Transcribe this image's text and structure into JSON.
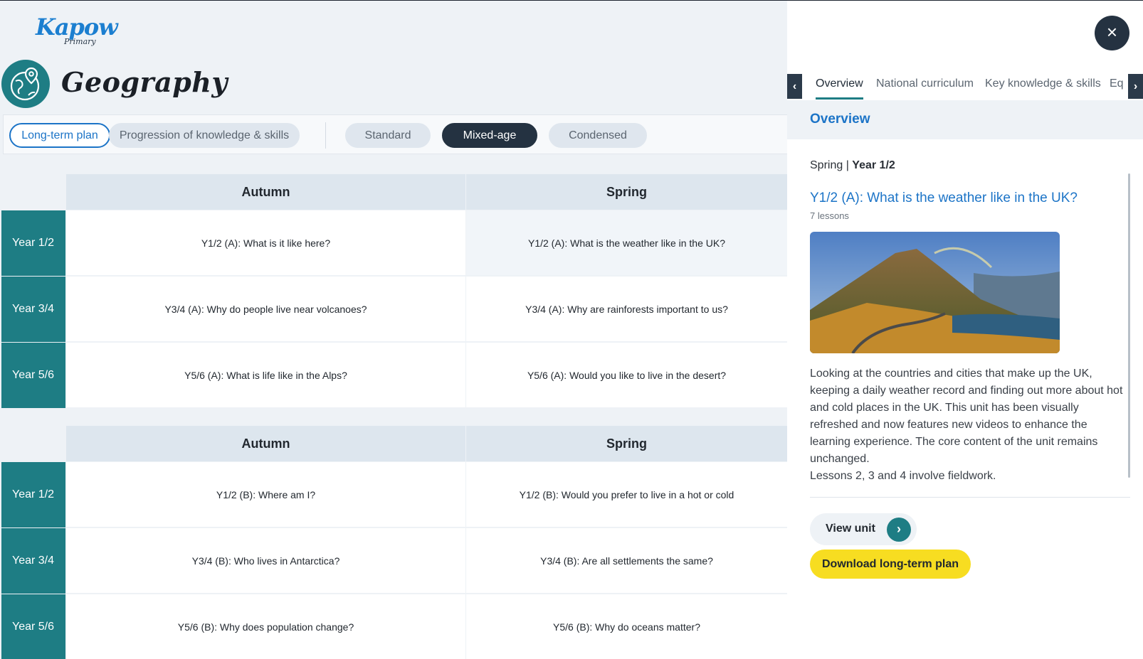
{
  "brand": {
    "logo_text": "Kapow",
    "logo_sub": "Primary"
  },
  "subject": {
    "title": "Geography"
  },
  "plan_tabs": [
    {
      "label": "Long-term plan",
      "active": true
    },
    {
      "label": "Progression of knowledge & skills",
      "active": false
    }
  ],
  "plan_variants": [
    {
      "label": "Standard",
      "active": false
    },
    {
      "label": "Mixed-age",
      "active": true
    },
    {
      "label": "Condensed",
      "active": false
    }
  ],
  "tables": [
    {
      "headers": [
        "Autumn",
        "Spring"
      ],
      "rows": [
        {
          "label": "Year 1/2",
          "cells": [
            "Y1/2 (A): What is it like here?",
            "Y1/2 (A): What is the weather like in the UK?"
          ]
        },
        {
          "label": "Year 3/4",
          "cells": [
            "Y3/4 (A): Why do people live near volcanoes?",
            "Y3/4 (A): Why are rainforests important to us?"
          ]
        },
        {
          "label": "Year 5/6",
          "cells": [
            "Y5/6 (A): What is life like in the Alps?",
            "Y5/6 (A): Would you like to live in the desert?"
          ]
        }
      ]
    },
    {
      "headers": [
        "Autumn",
        "Spring"
      ],
      "rows": [
        {
          "label": "Year 1/2",
          "cells": [
            "Y1/2 (B): Where am I?",
            "Y1/2 (B): Would you prefer to live in a hot or cold"
          ]
        },
        {
          "label": "Year 3/4",
          "cells": [
            "Y3/4 (B): Who lives in Antarctica?",
            "Y3/4 (B): Are all settlements the same?"
          ]
        },
        {
          "label": "Year 5/6",
          "cells": [
            "Y5/6 (B): Why does population change?",
            "Y5/6 (B): Why do oceans matter?"
          ]
        }
      ]
    }
  ],
  "drawer": {
    "close_icon": "×",
    "tabs": [
      "Overview",
      "National curriculum",
      "Key knowledge & skills",
      "Eq"
    ],
    "section_title": "Overview",
    "crumb_term": "Spring",
    "crumb_sep": " | ",
    "crumb_year": "Year 1/2",
    "unit_title": "Y1/2 (A): What is the weather like in the UK?",
    "lesson_count": "7 lessons",
    "description": [
      "Looking at the countries and cities that make up the UK,",
      "keeping a daily weather record and finding out more about hot",
      "and cold places in the UK. This unit has been visually",
      "refreshed and now features new videos to enhance the",
      "learning experience. The core content of the unit remains",
      "unchanged.",
      "Lessons 2, 3 and 4 involve fieldwork."
    ],
    "view_unit_label": "View unit",
    "download_label": "Download long-term plan"
  },
  "icons": {
    "close": "close-icon",
    "prev": "chevron-left-icon",
    "next": "chevron-right-icon",
    "view_arrow": "chevron-right-icon",
    "subject": "globe-pin-icon"
  },
  "colors": {
    "teal": "#1e7d84",
    "blue": "#1c74c7",
    "dark": "#243241",
    "yellow": "#f7dd21"
  }
}
